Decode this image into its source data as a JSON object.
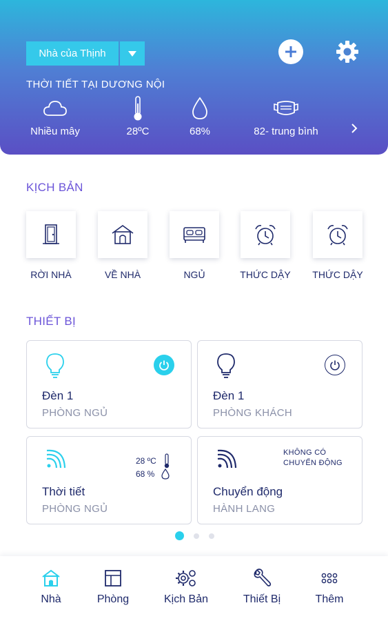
{
  "header": {
    "home_name": "Nhà của Thịnh",
    "weather_title": "THỜI TIẾT TẠI DƯƠNG NỘI",
    "weather": [
      {
        "icon": "cloud-icon",
        "value": "Nhiều mây"
      },
      {
        "icon": "thermometer-icon",
        "value": "28ºC"
      },
      {
        "icon": "humidity-drop-icon",
        "value": "68%"
      },
      {
        "icon": "air-quality-mask-icon",
        "value": "82- trung bình"
      }
    ],
    "next_icon": "chevron-right-icon"
  },
  "scenes": {
    "title": "KỊCH BẢN",
    "items": [
      {
        "icon": "door-icon",
        "label": "RỜI NHÀ"
      },
      {
        "icon": "house-icon",
        "label": "VỀ NHÀ"
      },
      {
        "icon": "bed-icon",
        "label": "NGỦ"
      },
      {
        "icon": "alarm-clock-icon",
        "label": "THỨC DẬY"
      },
      {
        "icon": "alarm-clock-icon",
        "label": "THỨC DẬY"
      }
    ]
  },
  "devices": {
    "title": "THIẾT BỊ",
    "cards": [
      {
        "name": "Đèn 1",
        "room": "PHÒNG NGỦ",
        "power": "on"
      },
      {
        "name": "Đèn 1",
        "room": "PHÒNG KHÁCH",
        "power": "off"
      },
      {
        "name": "Thời tiết",
        "room": "PHÒNG NGỦ",
        "temp": "28 ºC",
        "humidity": "68 %"
      },
      {
        "name": "Chuyển động",
        "room": "HÀNH LANG",
        "status_line1": "KHÔNG CÓ",
        "status_line2": "CHUYỂN ĐỘNG"
      }
    ],
    "page_count": 3,
    "active_page": 1
  },
  "nav": [
    {
      "icon": "home-icon",
      "label": "Nhà",
      "active": true
    },
    {
      "icon": "room-layout-icon",
      "label": "Phòng"
    },
    {
      "icon": "gears-icon",
      "label": "Kịch Bản"
    },
    {
      "icon": "wrench-icon",
      "label": "Thiết Bị"
    },
    {
      "icon": "more-dots-icon",
      "label": "Thêm"
    }
  ],
  "colors": {
    "accent": "#2ad0ec",
    "primary_text": "#1f2a6b",
    "section_title": "#6b54d8",
    "header_gradient_top": "#2db6dc",
    "header_gradient_bottom": "#5a4fc4"
  }
}
